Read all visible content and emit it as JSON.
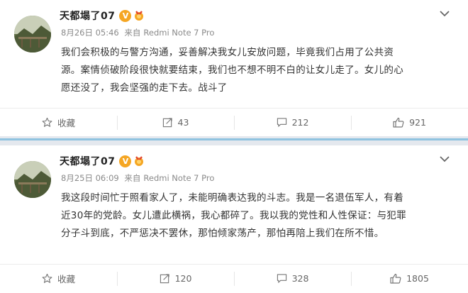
{
  "colors": {
    "accent_blue": "#8fc3e0",
    "separator_bg": "#e4e8ee",
    "verified_orange": "#f5a623"
  },
  "posts": [
    {
      "username": "天都塌了07",
      "verified_badge": "V",
      "date": "8月26日 05:46",
      "source_prefix": "来自",
      "source": "Redmi Note 7 Pro",
      "lines": [
        "我们会积极的与警方沟通，妥善解决我女儿安放问题，毕竟我们占用了公共资",
        "源。案情侦破阶段很快就要结束，我们也不想不明不白的让女儿走了。女儿的心",
        "愿还没了，我会坚强的走下去。战斗了"
      ],
      "actions": {
        "favorite_label": "收藏",
        "repost_count": "43",
        "comment_count": "212",
        "like_count": "921"
      },
      "icons": [
        "star-icon",
        "repost-icon",
        "comment-icon",
        "thumbs-up-icon",
        "chevron-down-icon"
      ]
    },
    {
      "username": "天都塌了07",
      "verified_badge": "V",
      "date": "8月25日 06:09",
      "source_prefix": "来自",
      "source": "Redmi Note 7 Pro",
      "lines": [
        "我这段时间忙于照看家人了，未能明确表达我的斗志。我是一名退伍军人，有着",
        "近30年的党龄。女儿遭此横祸，我心都碎了。我以我的党性和人性保证：与犯罪",
        "分子斗到底，不严惩决不罢休，那怕倾家荡产，那怕再陪上我们在所不惜。"
      ],
      "actions": {
        "favorite_label": "收藏",
        "repost_count": "120",
        "comment_count": "328",
        "like_count": "1805"
      },
      "icons": [
        "star-icon",
        "repost-icon",
        "comment-icon",
        "thumbs-up-icon",
        "chevron-down-icon"
      ]
    }
  ]
}
